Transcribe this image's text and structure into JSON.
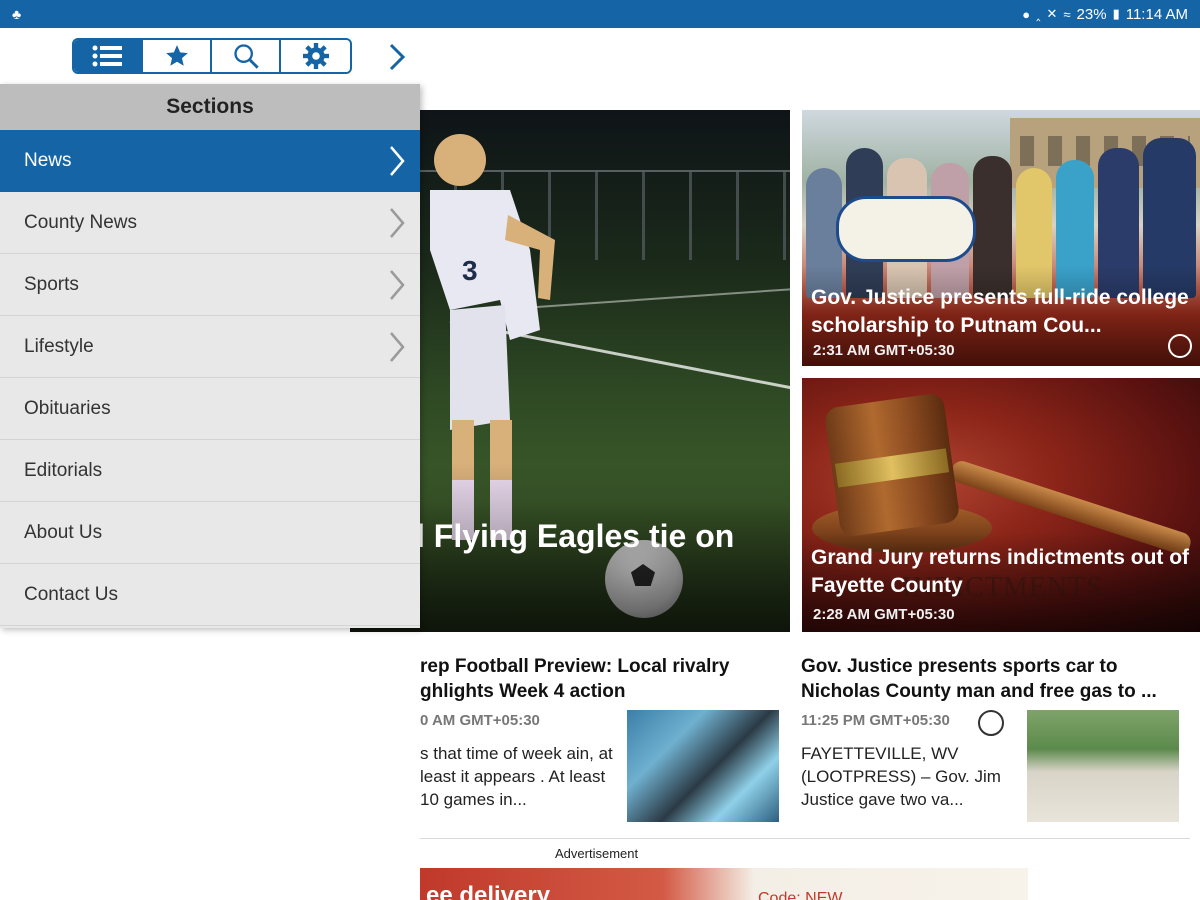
{
  "status_bar": {
    "battery": "23%",
    "time": "11:14 AM",
    "icons": [
      "app-icon",
      "location-icon",
      "bluetooth-icon",
      "mute-icon",
      "wifi-icon",
      "battery-icon"
    ]
  },
  "toolbar": {
    "buttons": [
      "sections-list-icon",
      "favorites-star-icon",
      "search-icon",
      "settings-gear-icon"
    ],
    "active_button": "sections-list-icon",
    "forward_icon": "chevron-right-icon"
  },
  "drawer": {
    "header": "Sections",
    "items": [
      {
        "label": "News",
        "has_children": true,
        "active": true
      },
      {
        "label": "County News",
        "has_children": true
      },
      {
        "label": "Sports",
        "has_children": true
      },
      {
        "label": "Lifestyle",
        "has_children": true
      },
      {
        "label": "Obituaries",
        "has_children": false
      },
      {
        "label": "Editorials",
        "has_children": false
      },
      {
        "label": "About Us",
        "has_children": false
      },
      {
        "label": "Contact Us",
        "has_children": false
      }
    ]
  },
  "hero": {
    "title": "l Flying Eagles tie on"
  },
  "cards": [
    {
      "title": "Gov. Justice presents full-ride college scholarship to Putnam Cou...",
      "time": "2:31 AM GMT+05:30",
      "gallery_icon": "gallery-icon"
    },
    {
      "title": "Grand Jury returns indictments out of Fayette County",
      "time": "2:28 AM GMT+05:30",
      "watermark": "INDICTMENTS"
    }
  ],
  "articles": [
    {
      "title_line1": "rep Football Preview: Local rivalry",
      "title_line2": "ghlights Week 4 action",
      "meta": "0 AM GMT+05:30",
      "snippet": "s that time of week ain, at least it appears . At least 10 games in..."
    },
    {
      "title_line1": "Gov. Justice presents sports car to",
      "title_line2": "Nicholas County man and free gas to ...",
      "meta": "11:25 PM GMT+05:30",
      "snippet": "FAYETTEVILLE, WV (LOOTPRESS) – Gov. Jim Justice gave two va..."
    }
  ],
  "advertisement": {
    "label": "Advertisement",
    "banner_text_left": "ee delivery",
    "banner_text_right": "Code: NEW..."
  },
  "colors": {
    "brand_blue": "#1565a6",
    "drawer_bg": "#e8e8e8",
    "drawer_header_bg": "#bdbdbd"
  }
}
